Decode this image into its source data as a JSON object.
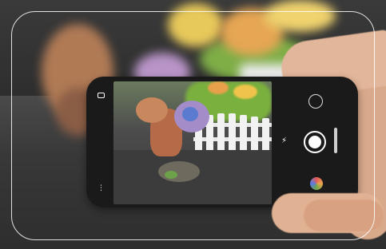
{
  "image": {
    "subject": "",
    "camera_ui": {
      "left_top_icon": "aspect-ratio-icon",
      "left_bottom_icon": "settings-icon",
      "right_top_icon": "switch-camera-icon",
      "flash_icon": "flash-icon",
      "shutter_icon": "shutter-button-icon",
      "gallery_icon": "gallery-thumbnail-icon"
    },
    "colors": {
      "phone_body": "#1a1a1a",
      "frame_outline": "#ffffff",
      "skin": "#e2b69a"
    }
  }
}
